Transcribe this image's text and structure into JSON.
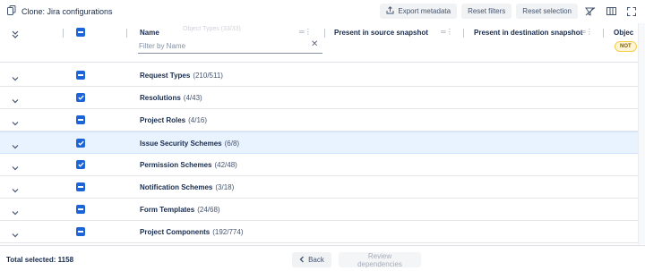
{
  "header": {
    "title": "Clone: Jira configurations",
    "export_label": "Export metadata",
    "reset_filters_label": "Reset filters",
    "reset_selection_label": "Reset selection"
  },
  "columns": {
    "name": "Name",
    "source": "Present in source snapshot",
    "destination": "Present in destination snapshot",
    "object": "Objec"
  },
  "filter": {
    "placeholder": "Filter by Name",
    "value": ""
  },
  "badge": "NOT",
  "rows": [
    {
      "name": "Request Types",
      "count": "(210/511)",
      "checked": false
    },
    {
      "name": "Resolutions",
      "count": "(4/43)",
      "checked": true
    },
    {
      "name": "Project Roles",
      "count": "(4/16)",
      "checked": false
    },
    {
      "name": "Issue Security Schemes",
      "count": "(6/8)",
      "checked": true,
      "selected": true
    },
    {
      "name": "Permission Schemes",
      "count": "(42/48)",
      "checked": true
    },
    {
      "name": "Notification Schemes",
      "count": "(3/18)",
      "checked": false
    },
    {
      "name": "Form Templates",
      "count": "(24/68)",
      "checked": false
    },
    {
      "name": "Project Components",
      "count": "(192/774)",
      "checked": false
    }
  ],
  "footer": {
    "total_label": "Total selected:",
    "total_value": "1158",
    "back_label": "Back",
    "review_label": "Review dependencies"
  },
  "colors": {
    "accent": "#1d64d8",
    "selected_row": "#e9f2ff"
  }
}
